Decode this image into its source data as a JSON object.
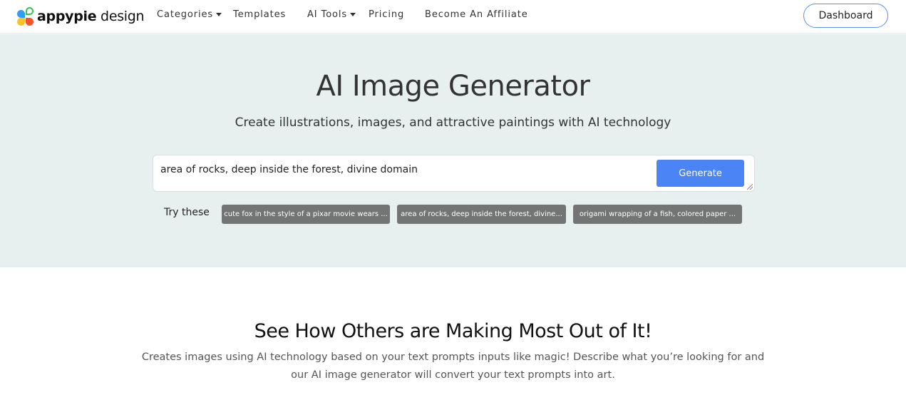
{
  "header": {
    "logo": {
      "brand_bold": "appypie",
      "brand_light": " design",
      "icon": "appypie-logo-icon"
    },
    "nav": [
      {
        "label": "Categories",
        "has_dropdown": true
      },
      {
        "label": "Templates",
        "has_dropdown": false
      },
      {
        "label": "AI Tools",
        "has_dropdown": true
      },
      {
        "label": "Pricing",
        "has_dropdown": false
      },
      {
        "label": "Become An Affiliate",
        "has_dropdown": false
      }
    ],
    "dashboard_label": "Dashboard"
  },
  "hero": {
    "title": "AI Image Generator",
    "subtitle": "Create illustrations, images, and attractive paintings with AI technology",
    "prompt_value": "area of rocks, deep inside the forest, divine domain",
    "generate_label": "Generate",
    "try_label": "Try these",
    "suggestions": [
      "cute fox in the style of a pixar movie wears ...",
      "area of rocks, deep inside the forest, divine...",
      "origami wrapping of a fish, colored paper ..."
    ]
  },
  "section": {
    "title": "See How Others are Making Most Out of It!",
    "description": "Creates images using AI technology based on your text prompts inputs like magic! Describe what you’re looking for and our AI image generator will convert your text prompts into art."
  },
  "colors": {
    "accent": "#4b84f5",
    "hero_background": "#e8f0ef",
    "chip_background": "#737575",
    "dashboard_border": "#5b8ff0"
  }
}
